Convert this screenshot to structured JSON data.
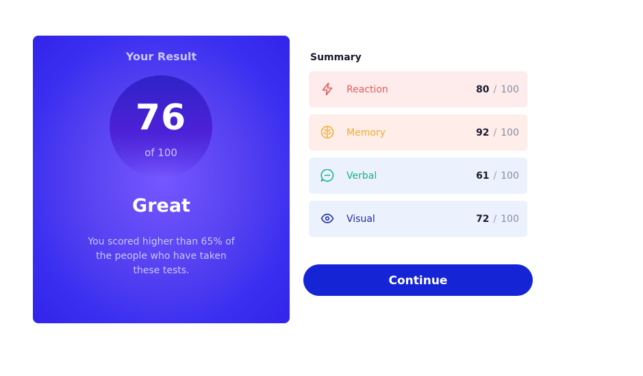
{
  "result": {
    "title": "Your Result",
    "score": "76",
    "of_text": "of 100",
    "grade": "Great",
    "description": "You scored higher than 65% of the people who have taken these tests."
  },
  "summary": {
    "title": "Summary",
    "items": [
      {
        "label": "Reaction",
        "score": "80",
        "separator": "/",
        "max": "100",
        "icon": "lightning-icon",
        "bg": "#fdeceb",
        "color": "#e35a5a"
      },
      {
        "label": "Memory",
        "score": "92",
        "separator": "/",
        "max": "100",
        "icon": "brain-icon",
        "bg": "#feede9",
        "color": "#f4ad2c"
      },
      {
        "label": "Verbal",
        "score": "61",
        "separator": "/",
        "max": "100",
        "icon": "chat-icon",
        "bg": "#ebf1fd",
        "color": "#16b48f"
      },
      {
        "label": "Visual",
        "score": "72",
        "separator": "/",
        "max": "100",
        "icon": "eye-icon",
        "bg": "#ebf1fd",
        "color": "#1f2b9e"
      }
    ]
  },
  "actions": {
    "continue_label": "Continue"
  },
  "colors": {
    "card_gradient_start": "#7657ff",
    "card_gradient_end": "#3224e9",
    "button": "#1525d6"
  }
}
